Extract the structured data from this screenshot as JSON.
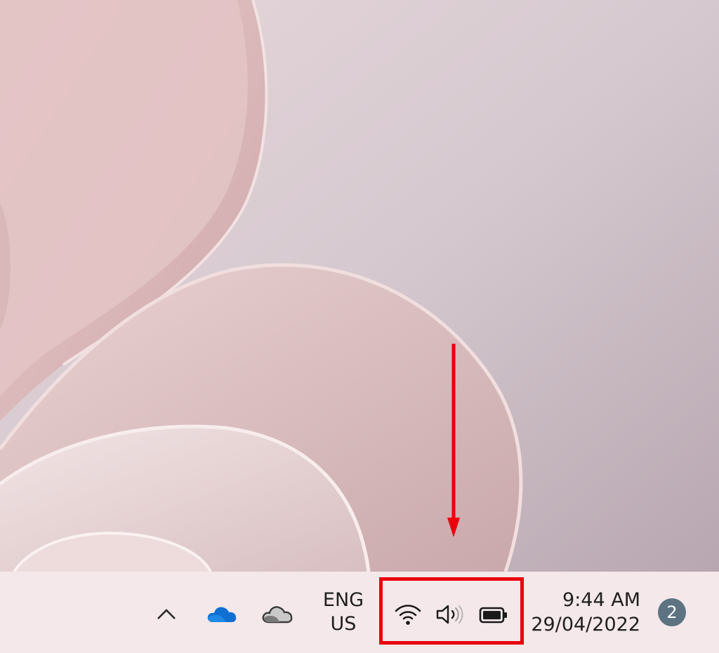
{
  "taskbar": {
    "tray": {
      "chevron_icon": "chevron-up-icon",
      "onedrive_icon": "onedrive-cloud-icon",
      "cloud_icon": "cloud-icon"
    },
    "language": {
      "line1": "ENG",
      "line2": "US"
    },
    "quick_settings": {
      "icons": [
        "wifi-icon",
        "volume-icon",
        "battery-icon"
      ],
      "highlight_color": "#e8000b"
    },
    "clock": {
      "time": "9:44 AM",
      "date": "29/04/2022"
    },
    "notifications": {
      "count": "2",
      "badge_color": "#5d7381"
    }
  },
  "annotation": {
    "arrow_color": "#e8000b"
  }
}
